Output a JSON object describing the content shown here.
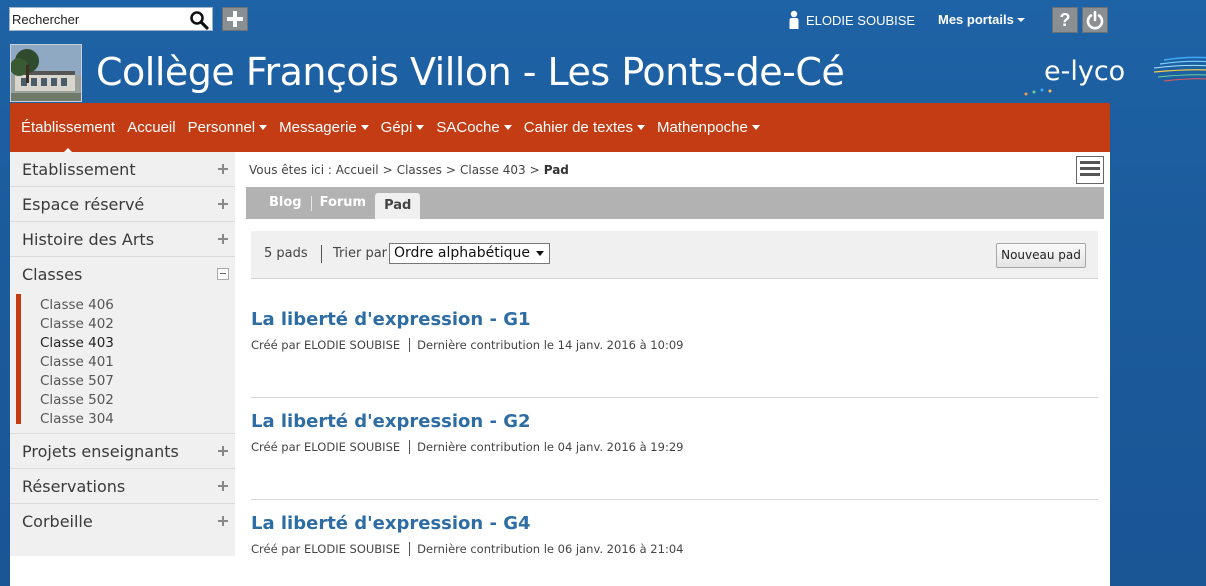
{
  "topbar": {
    "search_placeholder": "Rechercher",
    "user_name": "ELODIE SOUBISE",
    "portals_label": "Mes portails",
    "help_label": "?"
  },
  "banner": {
    "school_name": "Collège François Villon - Les Ponts-de-Cé",
    "logo_text": "e-lyco"
  },
  "nav": {
    "items": [
      {
        "label": "Établissement",
        "dropdown": false,
        "active": true
      },
      {
        "label": "Accueil",
        "dropdown": false
      },
      {
        "label": "Personnel",
        "dropdown": true
      },
      {
        "label": "Messagerie",
        "dropdown": true
      },
      {
        "label": "Gépi",
        "dropdown": true
      },
      {
        "label": "SACoche",
        "dropdown": true
      },
      {
        "label": "Cahier de textes",
        "dropdown": true
      },
      {
        "label": "Mathenpoche",
        "dropdown": true
      }
    ]
  },
  "sidebar": {
    "items": [
      {
        "label": "Etablissement"
      },
      {
        "label": "Espace réservé"
      },
      {
        "label": "Histoire des Arts"
      },
      {
        "label": "Classes"
      },
      {
        "label": "Projets enseignants"
      },
      {
        "label": "Réservations"
      },
      {
        "label": "Corbeille"
      }
    ],
    "classes": [
      "Classe 406",
      "Classe 402",
      "Classe 403",
      "Classe 401",
      "Classe 507",
      "Classe 502",
      "Classe 304"
    ]
  },
  "breadcrumb": {
    "prefix": "Vous êtes ici :",
    "items": [
      "Accueil",
      "Classes",
      "Classe 403"
    ],
    "current": "Pad",
    "separator": ">"
  },
  "tabs": [
    "Blog",
    "Forum",
    "Pad"
  ],
  "toolbar": {
    "count": "5 pads",
    "sort_label": "Trier par",
    "sort_value": "Ordre alphabétique",
    "new_button": "Nouveau pad"
  },
  "pads": [
    {
      "title": "La liberté d'expression - G1",
      "author": "Créé par ELODIE SOUBISE",
      "last": "Dernière contribution le 14 janv. 2016 à 10:09"
    },
    {
      "title": "La liberté d'expression - G2",
      "author": "Créé par ELODIE SOUBISE",
      "last": "Dernière contribution le 04 janv. 2016 à 19:29"
    },
    {
      "title": "La liberté d'expression - G4",
      "author": "Créé par ELODIE SOUBISE",
      "last": "Dernière contribution le 06 janv. 2016 à 21:04"
    }
  ],
  "colors": {
    "background": "#1e63a6",
    "nav_bar": "#c43c14",
    "link": "#2e6da4",
    "tab_bar": "#b2b2b2"
  }
}
